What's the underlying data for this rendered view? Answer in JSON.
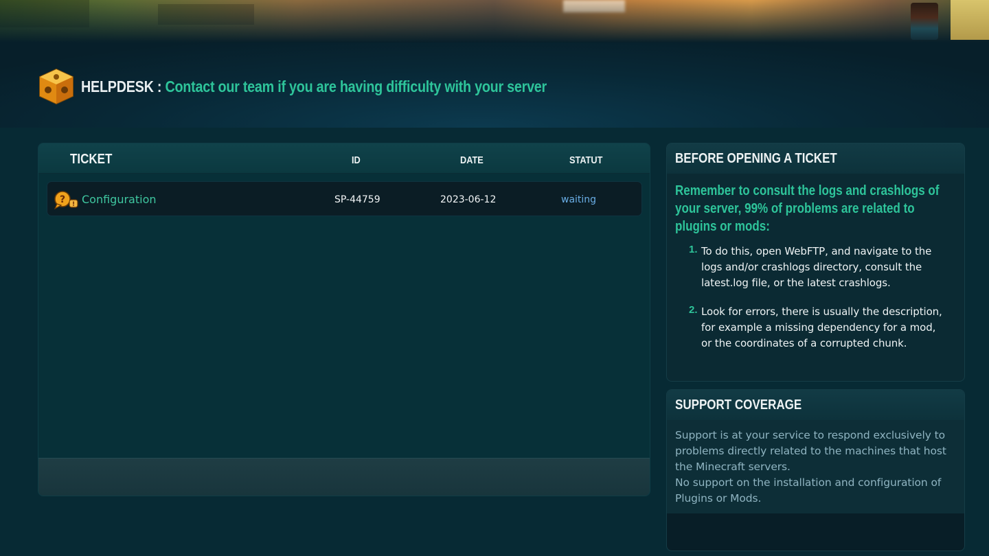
{
  "header": {
    "label": "HELPDESK :",
    "subtitle": "Contact our team if you are having difficulty with your server",
    "logo_icon": "helpdesk-cube-icon"
  },
  "tickets": {
    "columns": {
      "ticket": "TICKET",
      "id": "ID",
      "date": "DATE",
      "status": "STATUT"
    },
    "rows": [
      {
        "icon": "question-speech-bubble-icon",
        "name": "Configuration",
        "id": "SP-44759",
        "date": "2023-06-12",
        "status": "waiting"
      }
    ]
  },
  "before_ticket": {
    "title": "BEFORE OPENING A TICKET",
    "intro": "Remember to consult the logs and crashlogs of your server, 99% of problems are related to plugins or mods:",
    "steps": [
      {
        "num": "1.",
        "text": "To do this, open WebFTP, and navigate to the logs and/or crashlogs directory, consult the latest.log file, or the latest crashlogs."
      },
      {
        "num": "2.",
        "text": "Look for errors, there is usually the description, for example a missing dependency for a mod, or the coordinates of a corrupted chunk."
      }
    ]
  },
  "coverage": {
    "title": "SUPPORT COVERAGE",
    "paragraph1": "Support is at your service to respond exclusively to problems directly related to the machines that host the Minecraft servers.",
    "paragraph2": "No support on the installation and configuration of Plugins or Mods."
  },
  "colors": {
    "accent_green": "#2ec49a",
    "status_blue": "#6aaee6",
    "background": "#072a34"
  }
}
